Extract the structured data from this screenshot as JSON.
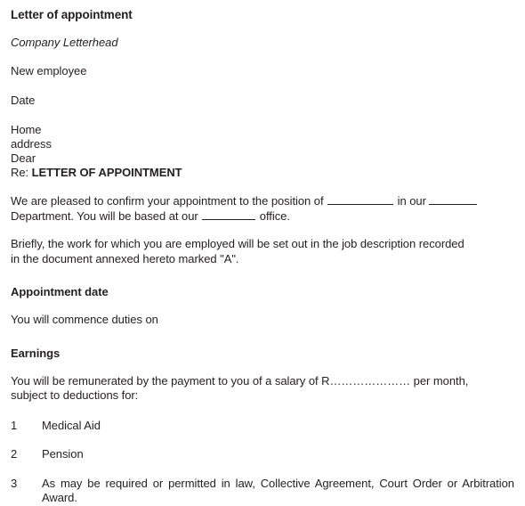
{
  "document": {
    "title": "Letter of appointment",
    "letterhead": "Company Letterhead",
    "recipient_label": "New employee",
    "date_label": "Date",
    "address": {
      "line1": "Home",
      "line2": "address",
      "salutation": "Dear"
    },
    "subject": {
      "prefix": "Re: ",
      "text": "LETTER OF APPOINTMENT"
    },
    "paragraphs": {
      "confirmation_part1": "We are pleased to confirm your appointment to the position of ",
      "confirmation_part2": " in our ",
      "confirmation_part3": "Department. You will be based at our ",
      "confirmation_part4": " office.",
      "job_description": "Briefly, the work for which you are employed will be set out in the job description recorded in the document annexed hereto marked \"A\"."
    },
    "sections": [
      {
        "heading": "Appointment date",
        "body": "You will commence duties on"
      },
      {
        "heading": "Earnings",
        "body": "You will be remunerated by the payment to you of a salary of R………………… per month, subject to deductions for:"
      }
    ],
    "deductions": [
      {
        "number": "1",
        "text": "Medical Aid"
      },
      {
        "number": "2",
        "text": "Pension"
      },
      {
        "number": "3",
        "text": "As may be required or permitted in law, Collective Agreement, Court Order or Arbitration Award."
      }
    ]
  },
  "colors": {
    "text": "#231f20",
    "background": "#ffffff",
    "rule": "#231f20"
  }
}
